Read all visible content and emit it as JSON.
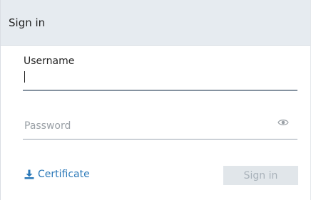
{
  "header": {
    "title": "Sign in"
  },
  "form": {
    "username_label": "Username",
    "username_value": "",
    "password_placeholder": "Password",
    "password_value": "",
    "certificate_label": "Certificate",
    "submit_label": "Sign in",
    "submit_disabled": true
  },
  "icons": {
    "password_toggle": "eye-icon",
    "certificate": "download-icon"
  },
  "colors": {
    "header_bg": "#e6ebf0",
    "link": "#2a78b8",
    "button_disabled_bg": "#e1e6ea",
    "button_disabled_text": "#a9b2ba"
  }
}
